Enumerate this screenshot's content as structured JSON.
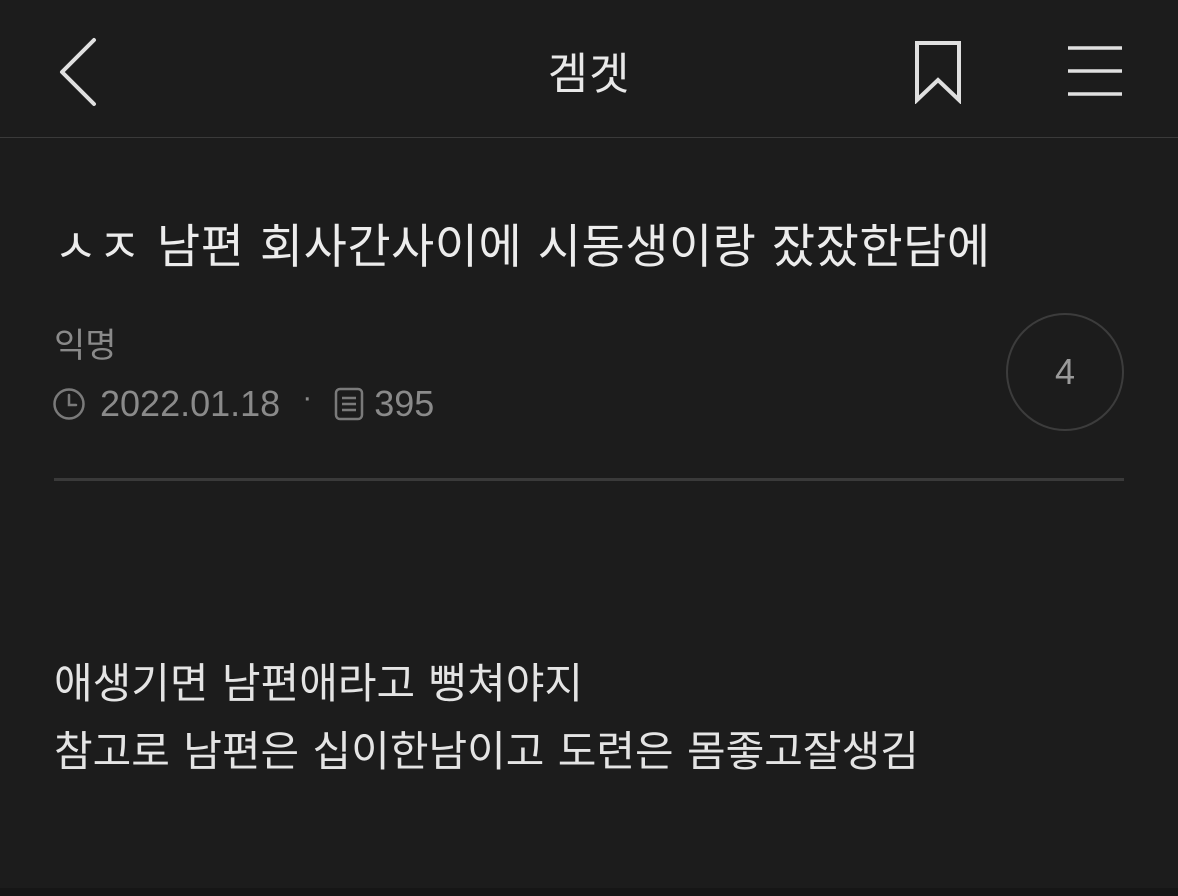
{
  "header": {
    "board_name": "겜겟"
  },
  "post": {
    "title": "ㅅㅈ 남편 회사간사이에 시동생이랑 잤잤한담에",
    "author": "익명",
    "date": "2022.01.18",
    "separator": "·",
    "views": "395",
    "comment_count": "4",
    "body_lines": [
      "애생기면 남편애라고 뻥쳐야지",
      "참고로 남편은 십이한남이고 도련은 몸좋고잘생김"
    ]
  },
  "icons": {
    "back": "chevron-left-icon",
    "bookmark": "bookmark-icon",
    "menu": "hamburger-menu-icon",
    "clock": "clock-icon",
    "views": "document-icon"
  },
  "colors": {
    "background": "#1c1c1c",
    "text_primary": "#e6e6e6",
    "text_secondary": "#8a8a8a",
    "divider": "#3a3a3a"
  }
}
